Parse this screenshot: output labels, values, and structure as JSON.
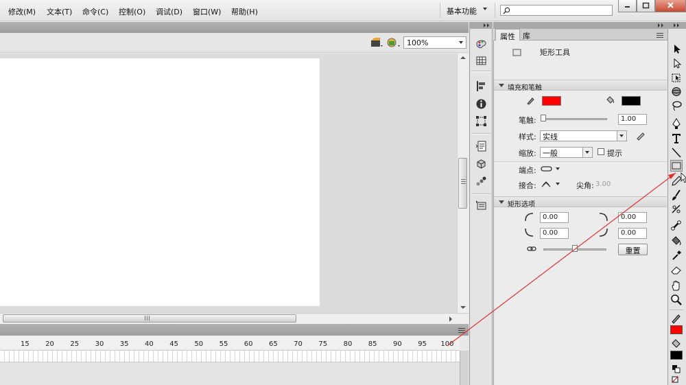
{
  "menubar": {
    "items": [
      "修改(M)",
      "文本(T)",
      "命令(C)",
      "控制(O)",
      "调试(D)",
      "窗口(W)",
      "帮助(H)"
    ],
    "workspace": "基本功能"
  },
  "search": {
    "placeholder": ""
  },
  "stage": {
    "zoom": "100%"
  },
  "timeline": {
    "ticks": [
      "15",
      "20",
      "25",
      "30",
      "35",
      "40",
      "45",
      "50",
      "55",
      "60",
      "65",
      "70",
      "75",
      "80",
      "85",
      "90",
      "95",
      "100"
    ]
  },
  "properties": {
    "tabs": [
      "属性",
      "库"
    ],
    "tool_name": "矩形工具",
    "section_fill_stroke": "填充和笔触",
    "stroke_label": "笔触:",
    "stroke_value": "1.00",
    "style_label": "样式:",
    "style_value": "实线",
    "scale_label": "缩放:",
    "scale_value": "一般",
    "hint_label": "提示",
    "cap_label": "端点:",
    "join_label": "接合:",
    "miter_label": "尖角:",
    "miter_value": "3.00",
    "section_rect": "矩形选项",
    "corner_top_left": "0.00",
    "corner_top_right": "0.00",
    "corner_bottom_left": "0.00",
    "corner_bottom_right": "0.00",
    "reset_label": "重置"
  },
  "colors": {
    "stroke": "#ff0000",
    "fill": "#000000",
    "annotation": "#e03030"
  },
  "icons": {
    "tools": [
      "selection-tool",
      "subselection-tool",
      "free-transform-tool",
      "3d-rotation-tool",
      "lasso-tool",
      "pen-tool",
      "text-tool",
      "line-tool",
      "rectangle-tool",
      "pencil-tool",
      "brush-tool",
      "deco-tool",
      "bone-tool",
      "paint-bucket-tool",
      "eyedropper-tool",
      "eraser-tool",
      "hand-tool",
      "zoom-tool"
    ]
  }
}
